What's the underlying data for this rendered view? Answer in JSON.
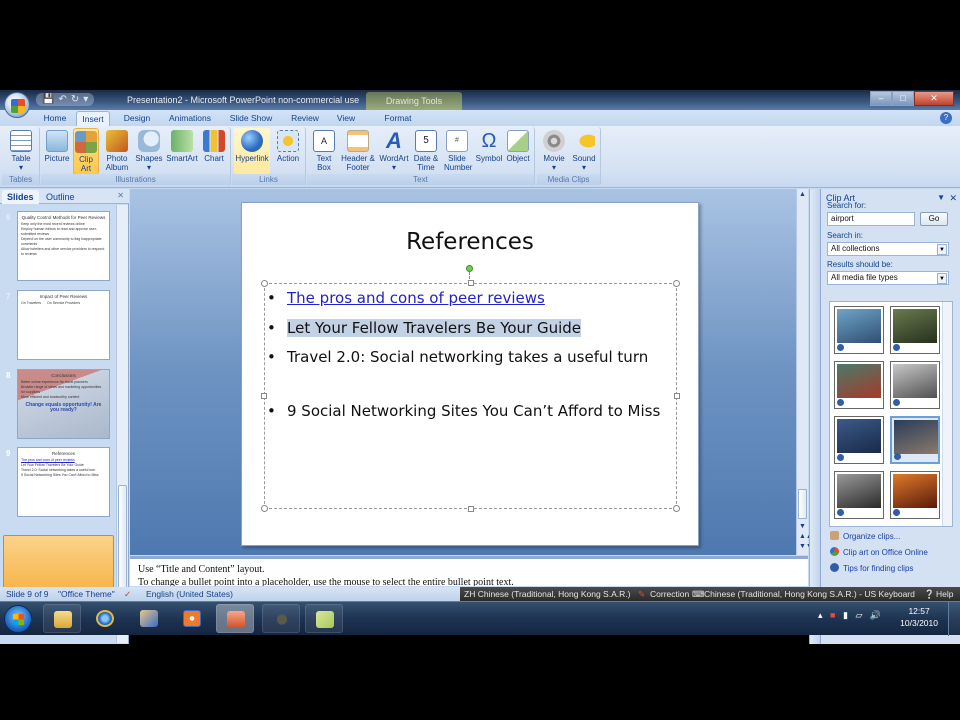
{
  "window": {
    "title": "Presentation2 - Microsoft PowerPoint non-commercial use",
    "context_tab": "Drawing Tools",
    "controls": [
      "minimize",
      "restore",
      "close"
    ]
  },
  "quick_access": [
    "save-icon",
    "undo-icon",
    "redo-icon",
    "customize-icon"
  ],
  "tabs": [
    {
      "label": "Home",
      "active": false
    },
    {
      "label": "Insert",
      "active": true
    },
    {
      "label": "Design",
      "active": false
    },
    {
      "label": "Animations",
      "active": false
    },
    {
      "label": "Slide Show",
      "active": false
    },
    {
      "label": "Review",
      "active": false
    },
    {
      "label": "View",
      "active": false
    },
    {
      "label": "Format",
      "active": false
    }
  ],
  "ribbon": {
    "groups": [
      {
        "label": "Tables",
        "buttons": [
          {
            "label": "Table",
            "icon": "table-icon",
            "dropdown": true
          }
        ]
      },
      {
        "label": "Illustrations",
        "buttons": [
          {
            "label": "Picture",
            "icon": "picture-icon"
          },
          {
            "label": "Clip Art",
            "icon": "clip-art-icon",
            "active": true
          },
          {
            "label": "Photo Album",
            "icon": "photo-album-icon",
            "dropdown": true
          },
          {
            "label": "Shapes",
            "icon": "shapes-icon",
            "dropdown": true
          },
          {
            "label": "SmartArt",
            "icon": "smartart-icon"
          },
          {
            "label": "Chart",
            "icon": "chart-icon"
          }
        ]
      },
      {
        "label": "Links",
        "buttons": [
          {
            "label": "Hyperlink",
            "icon": "hyperlink-icon",
            "hover": true
          },
          {
            "label": "Action",
            "icon": "action-icon"
          }
        ]
      },
      {
        "label": "Text",
        "buttons": [
          {
            "label": "Text Box",
            "icon": "text-box-icon",
            "dropdown": true
          },
          {
            "label": "Header & Footer",
            "icon": "header-footer-icon"
          },
          {
            "label": "WordArt",
            "icon": "wordart-icon",
            "dropdown": true
          },
          {
            "label": "Date & Time",
            "icon": "date-time-icon"
          },
          {
            "label": "Slide Number",
            "icon": "slide-number-icon"
          },
          {
            "label": "Symbol",
            "icon": "symbol-icon"
          },
          {
            "label": "Object",
            "icon": "object-icon"
          }
        ]
      },
      {
        "label": "Media Clips",
        "buttons": [
          {
            "label": "Movie",
            "icon": "movie-icon",
            "dropdown": true
          },
          {
            "label": "Sound",
            "icon": "sound-icon",
            "dropdown": true
          }
        ]
      }
    ]
  },
  "left_pane": {
    "tabs": [
      "Slides",
      "Outline"
    ],
    "active_tab": "Slides",
    "slides": [
      {
        "number": "6",
        "title": "Quality Control Methods for Peer Reviews",
        "lines": [
          "Keep only the most recent reviews online",
          "Employ human editors to read and approve user-submitted reviews",
          "Depend on the user community to flag inappropriate comments",
          "Allow hoteliers and other service providers to respond to reviews"
        ]
      },
      {
        "number": "7",
        "title": "Impact of Peer Reviews",
        "lines": [
          "On Travelers",
          "On Service Providers"
        ]
      },
      {
        "number": "8",
        "title": "Conclusions",
        "lines": [
          "Better online experience for travel planners",
          "Broader range of views and marketing opportunities for suppliers",
          "More efficient and trustworthy content"
        ],
        "callout": "Change equals opportunity! Are you ready?"
      },
      {
        "number": "9",
        "title": "References",
        "lines": [
          "The pros and cons of peer reviews",
          "Let Your Fellow Travelers Be Your Guide",
          "Travel 2.0: Social networking takes a useful turn",
          "9 Social Networking Sites You Can't Afford to Miss"
        ],
        "selected": true
      }
    ]
  },
  "slide": {
    "title": "References",
    "bullets": [
      {
        "text": "The pros and cons of peer reviews",
        "hyperlink": true
      },
      {
        "text": "Let Your Fellow Travelers Be Your Guide",
        "selected": true
      },
      {
        "text": "Travel 2.0: Social networking takes a useful turn"
      },
      {
        "text": "9 Social Networking Sites You Can’t Afford to Miss"
      }
    ]
  },
  "notes": {
    "line1": "Use “Title and Content” layout.",
    "line2": "To change a bullet point into a placeholder, use the mouse to select the entire bullet point text."
  },
  "clip_art": {
    "title": "Clip Art",
    "search_label": "Search for:",
    "search_value": "airport",
    "go_label": "Go",
    "search_in_label": "Search in:",
    "search_in_value": "All collections",
    "results_label": "Results should be:",
    "results_value": "All media file types",
    "results": [
      {
        "name": "airport-terminal-exterior",
        "colors": [
          "#6fa4c8",
          "#2e4f73"
        ]
      },
      {
        "name": "departures-board",
        "colors": [
          "#6a7a50",
          "#26301c"
        ]
      },
      {
        "name": "airport-corridor",
        "colors": [
          "#4a7a6a",
          "#a53a2a"
        ]
      },
      {
        "name": "traveler-silhouette",
        "colors": [
          "#c8c8c8",
          "#505050"
        ]
      },
      {
        "name": "woman-in-terminal",
        "colors": [
          "#3c5a8a",
          "#182a48"
        ]
      },
      {
        "name": "traveler-waiting",
        "colors": [
          "#2a3c5a",
          "#8a7a6a"
        ],
        "selected": true
      },
      {
        "name": "terminal-windows-bw",
        "colors": [
          "#9a9a9a",
          "#2a2a2a"
        ]
      },
      {
        "name": "airplane-sunset",
        "colors": [
          "#e07a2a",
          "#5a1a0a"
        ]
      }
    ],
    "links": [
      {
        "label": "Organize clips...",
        "icon": "organize-clips-icon"
      },
      {
        "label": "Clip art on Office Online",
        "icon": "office-online-icon"
      },
      {
        "label": "Tips for finding clips",
        "icon": "help-icon"
      }
    ]
  },
  "status_bar": {
    "slide": "Slide 9 of 9",
    "theme": "\"Office Theme\"",
    "language": "English (United States)"
  },
  "language_bar": {
    "input_language": "ZH Chinese (Traditional, Hong Kong S.A.R.)",
    "correction": "Correction",
    "keyboard": "Chinese (Traditional, Hong Kong S.A.R.) - US Keyboard",
    "help": "Help"
  },
  "taskbar": {
    "apps": [
      "windows-explorer",
      "internet-explorer",
      "paint-app",
      "media-player",
      "powerpoint",
      "recording-app",
      "sticky-notes"
    ],
    "active_app": "powerpoint",
    "time": "12:57",
    "date": "10/3/2010"
  }
}
